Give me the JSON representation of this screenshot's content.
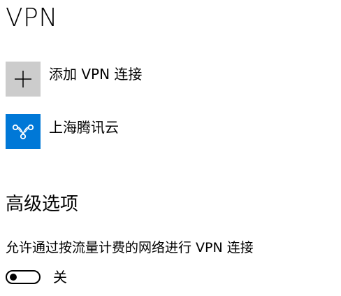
{
  "page": {
    "title": "VPN"
  },
  "add_vpn": {
    "label": "添加 VPN 连接",
    "icon": "plus-icon",
    "tile_color": "#cccccc"
  },
  "connections": [
    {
      "label": "上海腾讯云",
      "icon": "vpn-connection-icon",
      "tile_color": "#0078d7"
    }
  ],
  "advanced": {
    "heading": "高级选项",
    "metered": {
      "label": "允许通过按流量计费的网络进行 VPN 连接",
      "state_label": "关",
      "on": false
    }
  }
}
